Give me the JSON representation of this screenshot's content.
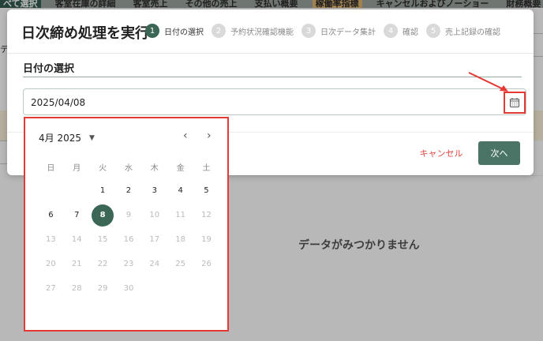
{
  "background": {
    "tabs": [
      {
        "label": "べて選択",
        "state": "active"
      },
      {
        "label": "客室在庫の詳細",
        "state": ""
      },
      {
        "label": "客室売上",
        "state": ""
      },
      {
        "label": "その他の売上",
        "state": ""
      },
      {
        "label": "支払い概要",
        "state": ""
      },
      {
        "label": "稼働率指標",
        "state": "hl"
      },
      {
        "label": "キャンセルおよびノーショー",
        "state": ""
      },
      {
        "label": "財務概要",
        "state": ""
      }
    ],
    "left_fragment": "テ",
    "empty_message": "データがみつかりません"
  },
  "dialog": {
    "title": "日次締め処理を実行",
    "steps": [
      {
        "num": "1",
        "label": "日付の選択",
        "active": true
      },
      {
        "num": "2",
        "label": "予約状況確認機能",
        "active": false
      },
      {
        "num": "3",
        "label": "日次データ集計",
        "active": false
      },
      {
        "num": "4",
        "label": "確認",
        "active": false
      },
      {
        "num": "5",
        "label": "売上記録の確認",
        "active": false
      }
    ],
    "section_title": "日付の選択",
    "date_value": "2025/04/08",
    "cancel_label": "キャンセル",
    "next_label": "次へ"
  },
  "datepicker": {
    "month_label": "4月 2025",
    "weekdays": [
      "日",
      "月",
      "火",
      "水",
      "木",
      "金",
      "土"
    ],
    "days": [
      {
        "label": "",
        "enabled": false
      },
      {
        "label": "",
        "enabled": false
      },
      {
        "label": "1",
        "enabled": true
      },
      {
        "label": "2",
        "enabled": true
      },
      {
        "label": "3",
        "enabled": true
      },
      {
        "label": "4",
        "enabled": true
      },
      {
        "label": "5",
        "enabled": true
      },
      {
        "label": "6",
        "enabled": true
      },
      {
        "label": "7",
        "enabled": true
      },
      {
        "label": "8",
        "enabled": true,
        "selected": true
      },
      {
        "label": "9",
        "enabled": false
      },
      {
        "label": "10",
        "enabled": false
      },
      {
        "label": "11",
        "enabled": false
      },
      {
        "label": "12",
        "enabled": false
      },
      {
        "label": "13",
        "enabled": false
      },
      {
        "label": "14",
        "enabled": false
      },
      {
        "label": "15",
        "enabled": false
      },
      {
        "label": "16",
        "enabled": false
      },
      {
        "label": "17",
        "enabled": false
      },
      {
        "label": "18",
        "enabled": false
      },
      {
        "label": "19",
        "enabled": false
      },
      {
        "label": "20",
        "enabled": false
      },
      {
        "label": "21",
        "enabled": false
      },
      {
        "label": "22",
        "enabled": false
      },
      {
        "label": "23",
        "enabled": false
      },
      {
        "label": "24",
        "enabled": false
      },
      {
        "label": "25",
        "enabled": false
      },
      {
        "label": "26",
        "enabled": false
      },
      {
        "label": "27",
        "enabled": false
      },
      {
        "label": "28",
        "enabled": false
      },
      {
        "label": "29",
        "enabled": false
      },
      {
        "label": "30",
        "enabled": false
      }
    ]
  },
  "colors": {
    "accent": "#3c6656",
    "annotation": "#e53935",
    "cancel": "#e0473f"
  }
}
